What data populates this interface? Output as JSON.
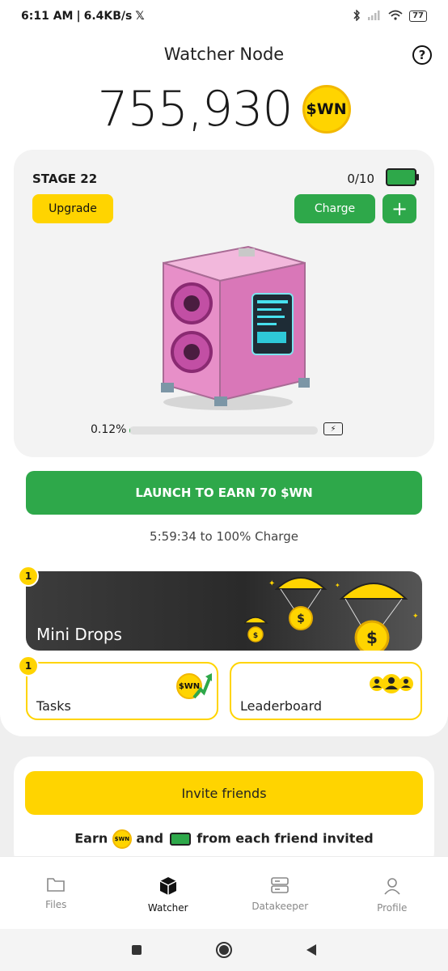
{
  "status_bar": {
    "time": "6:11 AM",
    "speed": "6.4KB/s",
    "battery": "77"
  },
  "header": {
    "title": "Watcher Node",
    "help_symbol": "?"
  },
  "balance": {
    "value": "755,930",
    "coin_label": "$WN"
  },
  "stage": {
    "label": "STAGE 22",
    "charge_count": "0/10",
    "upgrade_label": "Upgrade",
    "charge_label": "Charge",
    "plus_label": "+",
    "progress_text": "0.12%",
    "progress_fraction": 0.0012
  },
  "launch": {
    "label": "LAUNCH TO EARN 70 $WN",
    "countdown": "5:59:34 to 100% Charge"
  },
  "mini_drops": {
    "title": "Mini Drops",
    "badge": "1"
  },
  "tasks": {
    "label": "Tasks",
    "badge": "1",
    "coin_label": "$WN"
  },
  "leaderboard": {
    "label": "Leaderboard"
  },
  "invite": {
    "button_label": "Invite friends",
    "text_earn": "Earn",
    "text_and": "and",
    "text_rest": "from each friend invited",
    "coin_label": "$WN"
  },
  "nav": {
    "files": "Files",
    "watcher": "Watcher",
    "datakeeper": "Datakeeper",
    "profile": "Profile"
  },
  "colors": {
    "yellow": "#ffd400",
    "green": "#2ea84a",
    "dark": "#2a2a2a"
  }
}
